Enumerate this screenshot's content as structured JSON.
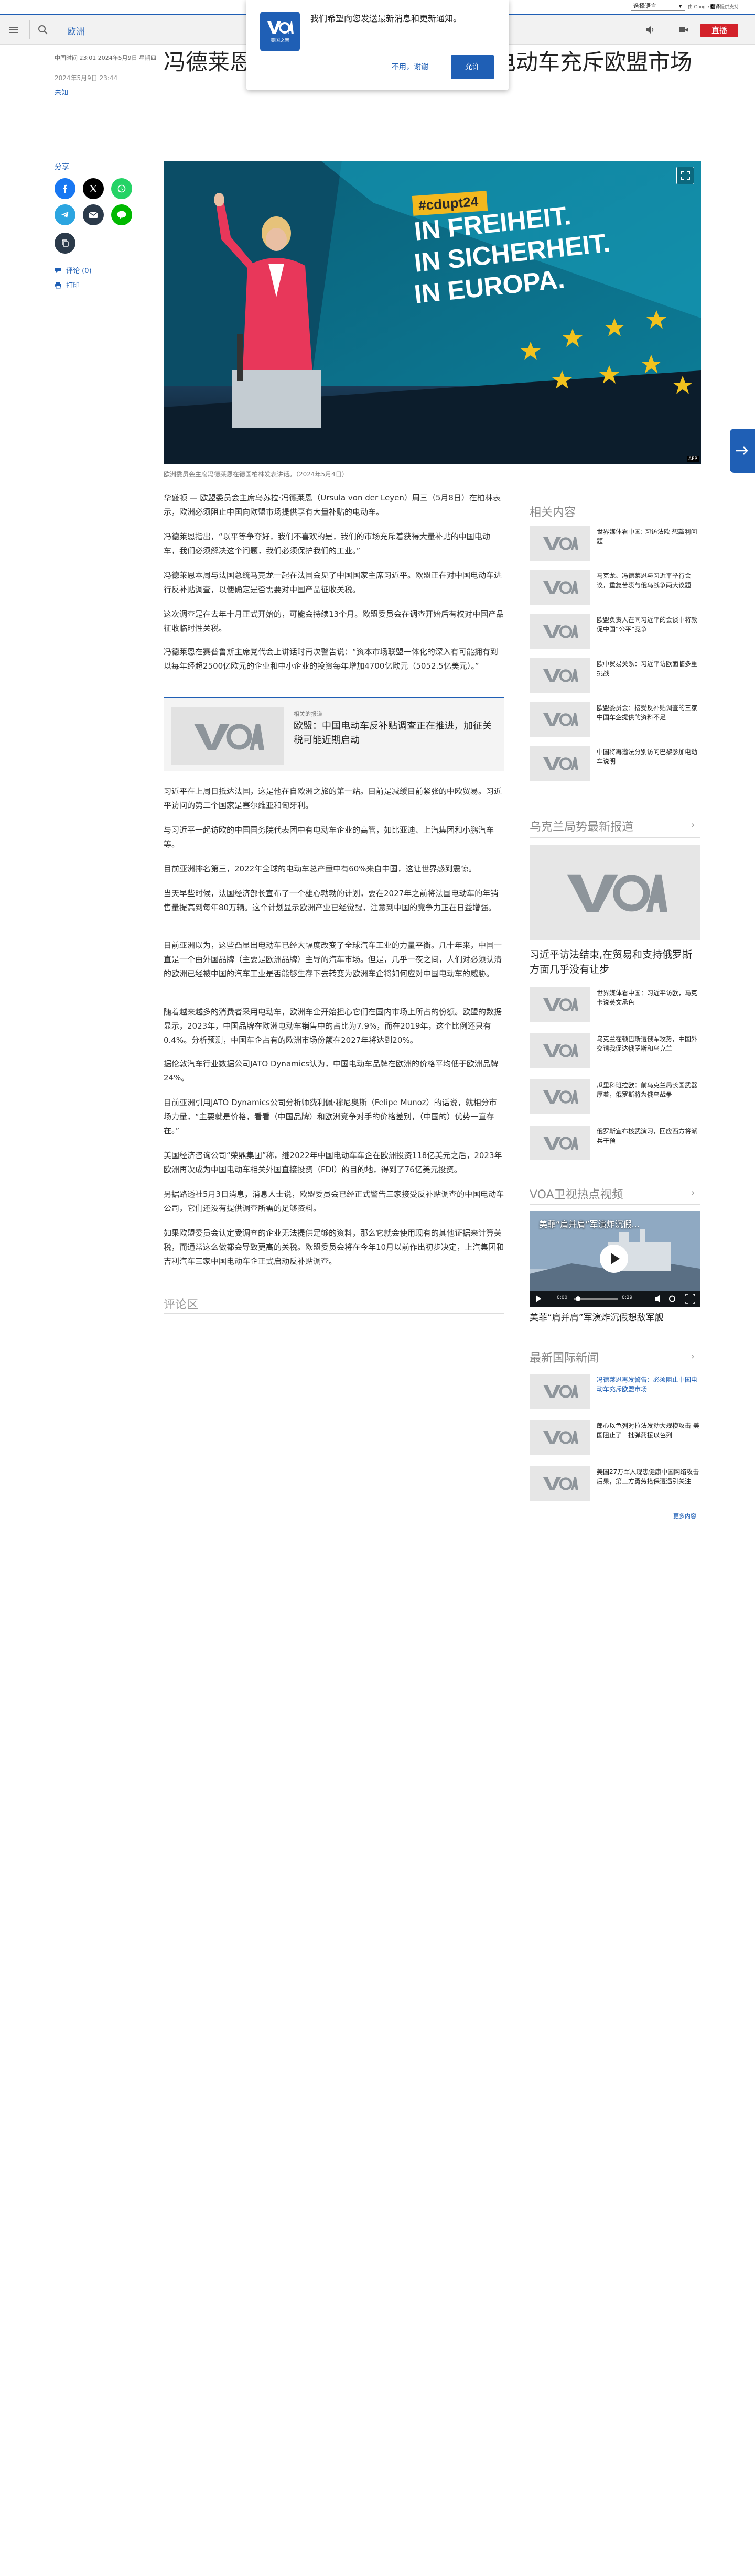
{
  "lang_bar": {
    "select_label": "选择语言",
    "note_powered": "由 Google ",
    "note_translate": "翻译",
    "note_tail": "提供支持"
  },
  "header": {
    "section": "欧洲",
    "live": "直播"
  },
  "notification": {
    "message": "我们希望向您发送最新消息和更新通知。",
    "logo_text": "VOA",
    "logo_sub": "美国之音",
    "decline": "不用，谢谢",
    "accept": "允许"
  },
  "article": {
    "dateline": "中国时间 23:01 2024年5月9日 星期四",
    "published": "2024年5月9日 23:44",
    "author": "未知",
    "title": "冯德莱恩再发警告：必须阻止中国电动车充斥欧盟市场",
    "share_label": "分享",
    "comments": "评论 (0)",
    "print": "打印",
    "image_banner": "#cdupt24",
    "image_text": [
      "IN FREIHEIT.",
      "IN SICHERHEIT.",
      "IN EUROPA."
    ],
    "image_credit": "AFP",
    "caption": "欧洲委员会主席冯德莱恩在德国柏林发表讲话。（2024年5月4日）",
    "paragraphs": [
      "华盛顿 — 欧盟委员会主席乌苏拉·冯德莱恩（Ursula von der Leyen）周三（5月8日）在柏林表示，欧洲必须阻止中国向欧盟市场提供享有大量补贴的电动车。",
      "冯德莱恩指出，“以平等争夺好，我们不喜欢的是，我们的市场充斥着获得大量补贴的中国电动车，我们必须解决这个问题，我们必须保护我们的工业。”",
      "冯德莱恩本周与法国总统马克龙一起在法国会见了中国国家主席习近平。欧盟正在对中国电动车进行反补贴调查，以便确定是否需要对中国产品征收关税。",
      "这次调查是在去年十月正式开始的，可能会持续13个月。欧盟委员会在调查开始后有权对中国产品征收临时性关税。",
      "冯德莱恩在赛普鲁斯主席党代会上讲话时再次警告说：“资本市场联盟一体化的深入有可能拥有到以每年经超2500亿欧元的企业和中小企业的投资每年增加4700亿欧元（5052.5亿美元）。”",
      "习近平在上周日抵达法国，这是他在自欧洲之旅的第一站。目前是减缓目前紧张的中欧贸易。习近平访问的第二个国家是塞尔维亚和匈牙利。",
      "与习近平一起访欧的中国国务院代表团中有电动车企业的高管，如比亚迪、上汽集团和小鹏汽车等。",
      "目前亚洲排名第三，2022年全球的电动车总产量中有60%来自中国，这让世界感到震惊。",
      "当天早些时候，法国经济部长宣布了一个雄心勃勃的计划，要在2027年之前将法国电动车的年销售量提高到每年80万辆。这个计划显示欧洲产业已经觉醒，注意到中国的竞争力正在日益增强。",
      "目前亚洲以为，这些凸显出电动车已经大幅度改变了全球汽车工业的力量平衡。几十年来，中国一直是一个由外国品牌（主要是欧洲品牌）主导的汽车市场。但是，几乎一夜之间，人们对必须认清的欧洲已经被中国的汽车工业是否能够生存下去转变为欧洲车企将如何应对中国电动车的威胁。",
      "随着越来越多的消费者采用电动车，欧洲车企开始担心它们在国内市场上所占的份额。欧盟的数据显示，2023年，中国品牌在欧洲电动车销售中的占比为7.9%，而在2019年，这个比例还只有0.4%。分析预测，中国车企占有的欧洲市场份额在2027年将达到20%。",
      "据伦敦汽车行业数据公司JATO Dynamics认为，中国电动车品牌在欧洲的价格平均低于欧洲品牌24%。",
      "目前亚洲引用JATO Dynamics公司分析师费利佩·穆尼奥斯（Felipe Munoz）的话说，就相分市场力量，“主要就是价格，看看（中国品牌）和欧洲竞争对手的价格差别，（中国的）优势一直存在。”",
      "美国经济咨询公司“荣鼎集团”称，继2022年中国电动车车企在欧洲投资118亿美元之后，2023年欧洲再次成为中国电动车相关外国直接投资（FDI）的目的地，得到了76亿美元投资。",
      "另据路透社5月3日消息，消息人士说，欧盟委员会已经正式警告三家接受反补贴调查的中国电动车公司，它们还没有提供调查所需的足够资料。",
      "如果欧盟委员会认定受调查的企业无法提供足够的资料，那么它就会使用现有的其他证据来计算关税，而通常这么做都会导致更高的关税。欧盟委员会将在今年10月以前作出初步决定，上汽集团和吉利汽车三家中国电动车企正式启动反补贴调查。"
    ],
    "related_label": "相关的报道",
    "related_title": "欧盟：中国电动车反补贴调查正在推进，加征关税可能近期启动"
  },
  "comments_title": "评论区",
  "sidebar": {
    "related": {
      "title": "相关内容",
      "items": [
        "世界媒体看中国: 习访法欧 想敲利问题",
        "马克龙、冯德莱恩与习近平举行会议，重复苦衷与俄乌战争两大议题",
        "欧盟负责人在同习近平的会谈中将敦促中国“公平”竞争",
        "欧中贸易关系：习近平访欧面临多重挑战",
        "欧盟委员会：接受反补贴调查的三家中国车企提供的资料不足",
        "中国将再邀法分别访问巴黎参加电动车说明"
      ]
    },
    "ukraine": {
      "title": "乌克兰局势最新报道",
      "big_title": "习近平访法结束,在贸易和支持俄罗斯方面几乎没有让步",
      "items": [
        "世界媒体看中国：习近平访欧，马克卡说英文承色",
        "乌克兰在顿巴斯遭俄军攻势，中国外交请我促达俄罗斯和乌克兰",
        "瓜里科班拉欧：前乌克兰局长国武器厚着，俄罗斯将为俄乌战争",
        "俄罗斯宣布核武演习，回应西方将派兵干预"
      ]
    },
    "video": {
      "title": "VOA卫视热点视频",
      "overlay": "美菲“肩并肩”军演炸沉假...",
      "time1": "0:00",
      "time2": "0:29",
      "caption": "美菲“肩并肩”军演炸沉假想敌军舰"
    },
    "intl": {
      "title": "最新国际新闻",
      "items": [
        "冯德莱恩再发警告：必须阻止中国电动车充斥欧盟市场",
        "郎心以色列对拉法发动大规模攻击 美国阻止了一批弹药援以色列",
        "美国27万军人现患健康中国网络攻击后果，第三方勇劳搭保遭遇引关注"
      ]
    },
    "more": "更多内容"
  },
  "colors": {
    "brand": "#1f5fb5",
    "live": "#d3222a"
  }
}
